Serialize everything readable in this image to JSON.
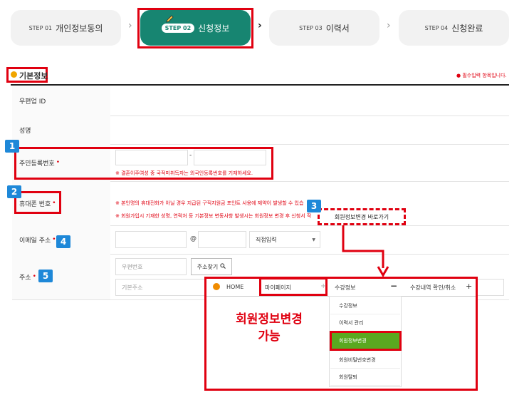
{
  "steps": [
    {
      "num": "STEP 01",
      "label": "개인정보동의"
    },
    {
      "num": "STEP 02",
      "label": "신청정보"
    },
    {
      "num": "STEP 03",
      "label": "이력서"
    },
    {
      "num": "STEP 04",
      "label": "신청완료"
    }
  ],
  "section": {
    "title": "기본정보",
    "required_note": "● 필수입력 항목입니다."
  },
  "fields": {
    "user_id": "우편업 ID",
    "name": "성명",
    "resident_no": "주민등록번호",
    "resident_sep": "-",
    "resident_note": "※ 결혼이주여성 중 국적미취득자는 외국인등록번호를 기재하세요.",
    "phone": "휴대폰 번호",
    "phone_note1": "※ 본인명의 휴대전화가 아닐 경우 지급된 구직지원금 포인트 사용에 제약이 발생할 수 있습",
    "phone_note2": "※ 회원가입시 기재한 성명, 연락처 등 기본정보 변동사항 발생시는 회원정보 변경 후 신청서 작",
    "member_link": "회원정보변경 바로가기",
    "email": "이메일 주소",
    "email_at": "@",
    "email_select": "직접입력",
    "address": "주소",
    "zip_placeholder": "우편번호",
    "zip_button": "주소찾기",
    "addr_placeholder": "기본주소"
  },
  "badges": [
    "1",
    "2",
    "3",
    "4",
    "5"
  ],
  "popup": {
    "home": "HOME",
    "mypage": "마이페이지",
    "course_info": "수강정보",
    "course_history": "수강내역 확인/취소",
    "menu": [
      "수강정보",
      "이력서 관리",
      "회원정보변경",
      "회원비밀번호변경",
      "회원탈퇴"
    ],
    "callout_line1": "회원정보변경",
    "callout_line2": "가능"
  },
  "colors": {
    "accent": "#178571",
    "annotation": "#e00010",
    "badge": "#1e88d8",
    "selected_menu": "#5aa820"
  }
}
